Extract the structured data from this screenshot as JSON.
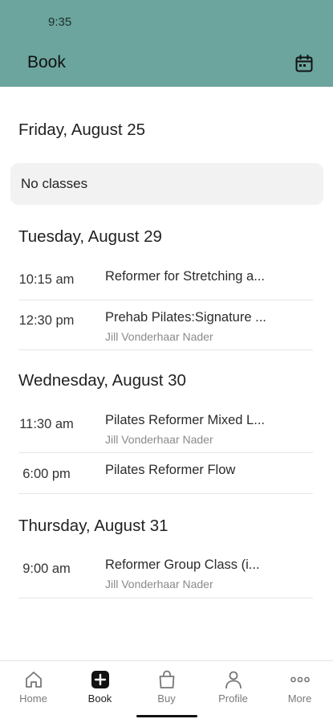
{
  "status_bar": {
    "time": "9:35"
  },
  "header": {
    "title": "Book",
    "calendar_icon": "calendar-icon"
  },
  "days": [
    {
      "heading": "Friday, August 25",
      "empty_message": "No classes",
      "classes": []
    },
    {
      "heading": "Tuesday, August 29",
      "classes": [
        {
          "time": "10:15 am",
          "name": "Reformer for Stretching a...",
          "instructor": ""
        },
        {
          "time": "12:30 pm",
          "name": "Prehab Pilates:Signature ...",
          "instructor": "Jill Vonderhaar Nader"
        }
      ]
    },
    {
      "heading": "Wednesday, August 30",
      "classes": [
        {
          "time": "11:30 am",
          "name": "Pilates Reformer Mixed L...",
          "instructor": "Jill Vonderhaar Nader"
        },
        {
          "time": "6:00 pm",
          "name": "Pilates Reformer Flow",
          "instructor": ""
        }
      ]
    },
    {
      "heading": "Thursday, August 31",
      "classes": [
        {
          "time": "9:00 am",
          "name": "Reformer Group Class (i...",
          "instructor": "Jill Vonderhaar Nader"
        }
      ]
    }
  ],
  "tabs": [
    {
      "label": "Home",
      "icon": "home-icon"
    },
    {
      "label": "Book",
      "icon": "plus-square-icon",
      "active": true
    },
    {
      "label": "Buy",
      "icon": "shopping-bag-icon"
    },
    {
      "label": "Profile",
      "icon": "person-icon"
    },
    {
      "label": "More",
      "icon": "more-dots-icon"
    }
  ],
  "colors": {
    "header_bg": "#6ba59d",
    "accent": "#111111"
  }
}
